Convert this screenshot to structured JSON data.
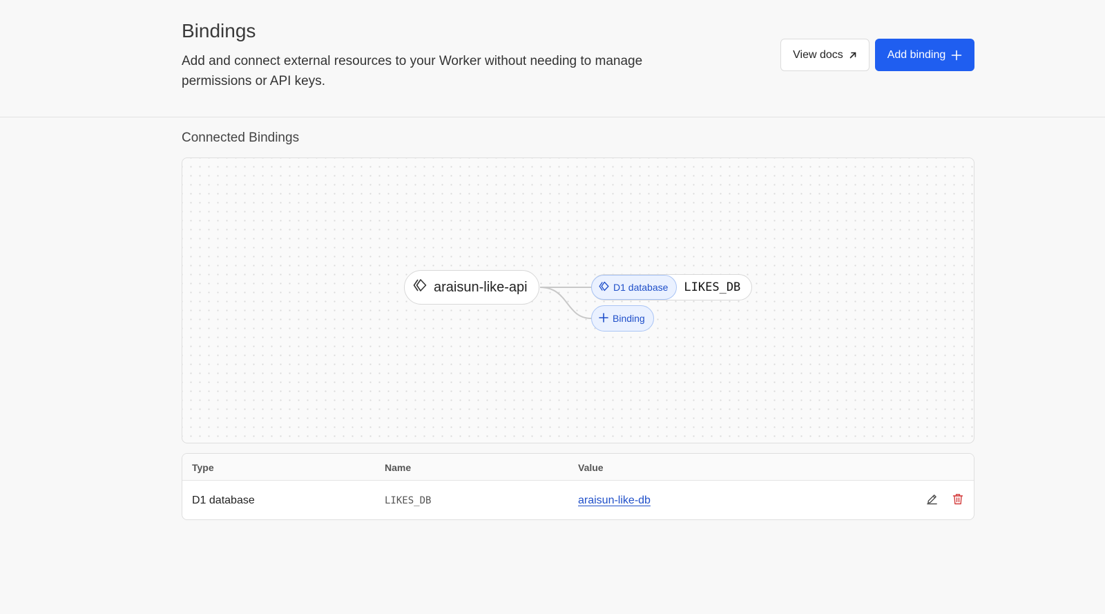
{
  "header": {
    "title": "Bindings",
    "description": "Add and connect external resources to your Worker without needing to manage permissions or API keys.",
    "view_docs_label": "View docs",
    "add_binding_label": "Add binding"
  },
  "connected": {
    "title": "Connected Bindings",
    "worker_name": "araisun-like-api",
    "binding_type": "D1 database",
    "binding_name": "LIKES_DB",
    "add_binding_node_label": "Binding"
  },
  "table": {
    "columns": [
      "Type",
      "Name",
      "Value"
    ],
    "rows": [
      {
        "type": "D1 database",
        "name": "LIKES_DB",
        "value": "araisun-like-db"
      }
    ]
  },
  "colors": {
    "accent": "#1f5ef0",
    "link": "#1f4fc9",
    "danger": "#d33a3a"
  },
  "icons": {
    "view_docs": "arrow-up-right-icon",
    "add_binding": "plus-icon",
    "worker": "worker-diamond-icon",
    "d1": "d1-database-icon",
    "add_node": "plus-icon",
    "edit": "pencil-icon",
    "delete": "trash-icon"
  }
}
